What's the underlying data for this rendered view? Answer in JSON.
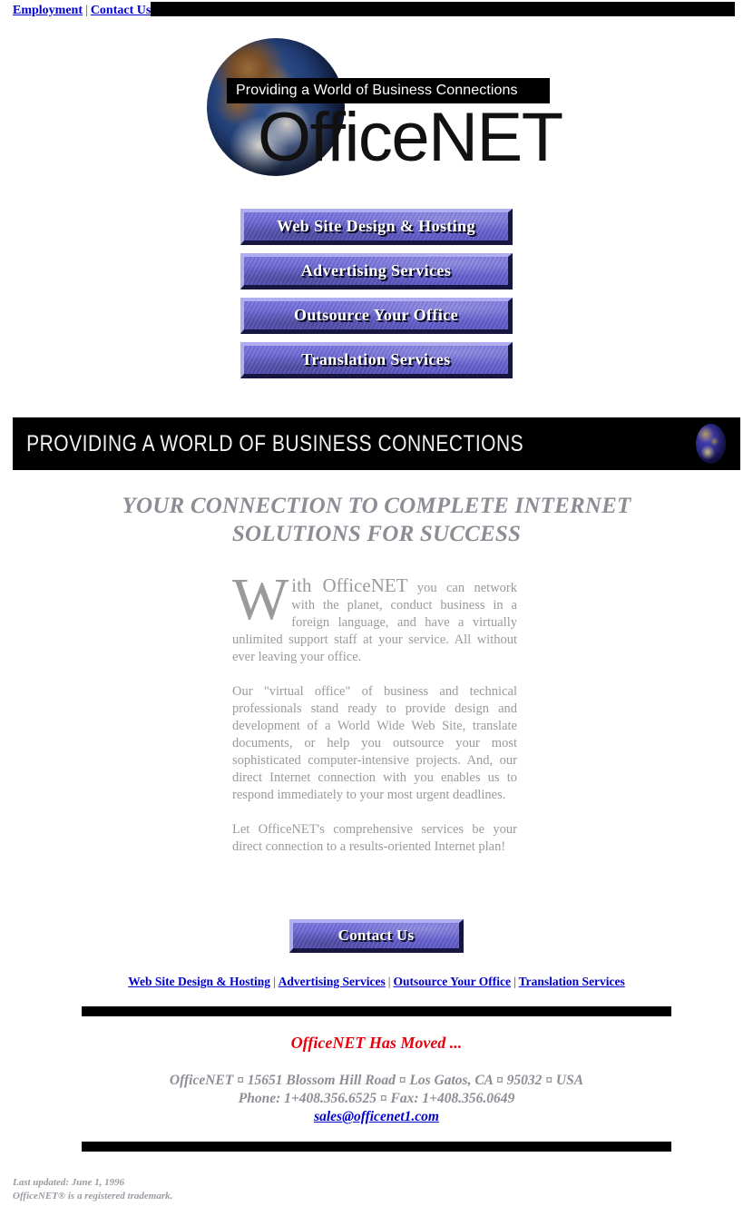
{
  "topbar": {
    "employment_label": "Employment",
    "separator": "|",
    "contact_label": "Contact Us"
  },
  "logo": {
    "tagline": "Providing a World of Business Connections",
    "wordmark": "OfficeNET"
  },
  "nav_buttons": [
    {
      "label": "Web Site Design & Hosting"
    },
    {
      "label": "Advertising Services"
    },
    {
      "label": "Outsource Your Office"
    },
    {
      "label": "Translation Services"
    }
  ],
  "banner": {
    "text": "PROVIDING A WORLD OF BUSINESS CONNECTIONS",
    "background_color": "#000000",
    "text_color": "#f2f2f2"
  },
  "headline": {
    "text": "YOUR CONNECTION TO COMPLETE INTERNET SOLUTIONS FOR SUCCESS",
    "color": "#8d8d95"
  },
  "body": {
    "dropcap": "W",
    "lead": "ith OfficeNET",
    "paragraph1": " you can network with the planet, conduct business in a foreign language, and have a virtually unlimited support staff at your service. All without ever leaving your office.",
    "paragraph2": "Our \"virtual office\" of business and technical professionals stand ready to provide design and development of a World Wide Web Site, translate documents, or help you outsource your most sophisticated computer-intensive projects. And, our direct Internet connection with you enables us to respond immediately to your most urgent deadlines.",
    "paragraph3": "Let OfficeNET's comprehensive services be your direct connection to a results-oriented Internet plan!",
    "text_color": "#9a9a9a"
  },
  "contact_button": {
    "label": "Contact Us"
  },
  "link_row": {
    "separator": "|",
    "links": [
      {
        "label": "Web Site Design & Hosting"
      },
      {
        "label": "Advertising Services"
      },
      {
        "label": "Outsource Your Office"
      },
      {
        "label": "Translation Services"
      }
    ]
  },
  "footer": {
    "moved_notice": "OfficeNET Has Moved ...",
    "moved_color": "#e8000d",
    "address_line": "OfficeNET ¤ 15651 Blossom Hill Road ¤ Los Gatos, CA ¤ 95032 ¤ USA",
    "phone_line": "Phone: 1+408.356.6525 ¤ Fax: 1+408.356.0649",
    "email": "sales@officenet1.com",
    "last_updated": "Last updated: June 1, 1996",
    "trademark": "OfficeNET® is a registered trademark."
  }
}
